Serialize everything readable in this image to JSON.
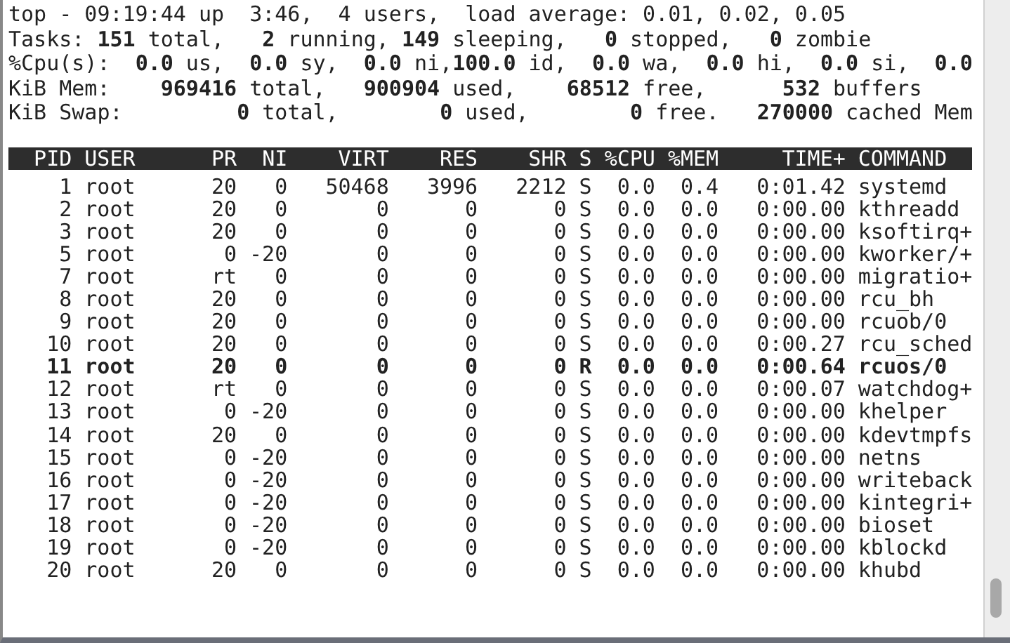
{
  "summary": [
    "top - 09:19:44 up  3:46,  4 users,  load average: 0.01, 0.02, 0.05",
    "Tasks: **151** total,   **2** running, **149** sleeping,   **0** stopped,   **0** zombie",
    "%Cpu(s):  **0.0** us,  **0.0** sy,  **0.0** ni,**100.0** id,  **0.0** wa,  **0.0** hi,  **0.0** si,  **0.0**",
    "KiB Mem:    **969416** total,   **900904** used,    **68512** free,      **532** buffers",
    "KiB Swap:         **0** total,        **0** used,        **0** free.   **270000** cached Mem"
  ],
  "table": {
    "columns": [
      "PID",
      "USER",
      "PR",
      "NI",
      "VIRT",
      "RES",
      "SHR",
      "S",
      "%CPU",
      "%MEM",
      "TIME+",
      "COMMAND"
    ],
    "rows": [
      {
        "cells": [
          "1",
          "root",
          "20",
          "0",
          "50468",
          "3996",
          "2212",
          "S",
          "0.0",
          "0.4",
          "0:01.42",
          "systemd"
        ],
        "highlighted": false
      },
      {
        "cells": [
          "2",
          "root",
          "20",
          "0",
          "0",
          "0",
          "0",
          "S",
          "0.0",
          "0.0",
          "0:00.00",
          "kthreadd"
        ],
        "highlighted": false
      },
      {
        "cells": [
          "3",
          "root",
          "20",
          "0",
          "0",
          "0",
          "0",
          "S",
          "0.0",
          "0.0",
          "0:00.00",
          "ksoftirq+"
        ],
        "highlighted": false
      },
      {
        "cells": [
          "5",
          "root",
          "0",
          "-20",
          "0",
          "0",
          "0",
          "S",
          "0.0",
          "0.0",
          "0:00.00",
          "kworker/+"
        ],
        "highlighted": false
      },
      {
        "cells": [
          "7",
          "root",
          "rt",
          "0",
          "0",
          "0",
          "0",
          "S",
          "0.0",
          "0.0",
          "0:00.00",
          "migratio+"
        ],
        "highlighted": false
      },
      {
        "cells": [
          "8",
          "root",
          "20",
          "0",
          "0",
          "0",
          "0",
          "S",
          "0.0",
          "0.0",
          "0:00.00",
          "rcu_bh"
        ],
        "highlighted": false
      },
      {
        "cells": [
          "9",
          "root",
          "20",
          "0",
          "0",
          "0",
          "0",
          "S",
          "0.0",
          "0.0",
          "0:00.00",
          "rcuob/0"
        ],
        "highlighted": false
      },
      {
        "cells": [
          "10",
          "root",
          "20",
          "0",
          "0",
          "0",
          "0",
          "S",
          "0.0",
          "0.0",
          "0:00.27",
          "rcu_sched"
        ],
        "highlighted": false
      },
      {
        "cells": [
          "11",
          "root",
          "20",
          "0",
          "0",
          "0",
          "0",
          "R",
          "0.0",
          "0.0",
          "0:00.64",
          "rcuos/0"
        ],
        "highlighted": true
      },
      {
        "cells": [
          "12",
          "root",
          "rt",
          "0",
          "0",
          "0",
          "0",
          "S",
          "0.0",
          "0.0",
          "0:00.07",
          "watchdog+"
        ],
        "highlighted": false
      },
      {
        "cells": [
          "13",
          "root",
          "0",
          "-20",
          "0",
          "0",
          "0",
          "S",
          "0.0",
          "0.0",
          "0:00.00",
          "khelper"
        ],
        "highlighted": false
      },
      {
        "cells": [
          "14",
          "root",
          "20",
          "0",
          "0",
          "0",
          "0",
          "S",
          "0.0",
          "0.0",
          "0:00.00",
          "kdevtmpfs"
        ],
        "highlighted": false
      },
      {
        "cells": [
          "15",
          "root",
          "0",
          "-20",
          "0",
          "0",
          "0",
          "S",
          "0.0",
          "0.0",
          "0:00.00",
          "netns"
        ],
        "highlighted": false
      },
      {
        "cells": [
          "16",
          "root",
          "0",
          "-20",
          "0",
          "0",
          "0",
          "S",
          "0.0",
          "0.0",
          "0:00.00",
          "writeback"
        ],
        "highlighted": false
      },
      {
        "cells": [
          "17",
          "root",
          "0",
          "-20",
          "0",
          "0",
          "0",
          "S",
          "0.0",
          "0.0",
          "0:00.00",
          "kintegri+"
        ],
        "highlighted": false
      },
      {
        "cells": [
          "18",
          "root",
          "0",
          "-20",
          "0",
          "0",
          "0",
          "S",
          "0.0",
          "0.0",
          "0:00.00",
          "bioset"
        ],
        "highlighted": false
      },
      {
        "cells": [
          "19",
          "root",
          "0",
          "-20",
          "0",
          "0",
          "0",
          "S",
          "0.0",
          "0.0",
          "0:00.00",
          "kblockd"
        ],
        "highlighted": false
      },
      {
        "cells": [
          "20",
          "root",
          "20",
          "0",
          "0",
          "0",
          "0",
          "S",
          "0.0",
          "0.0",
          "0:00.00",
          "khubd"
        ],
        "highlighted": false
      }
    ]
  }
}
